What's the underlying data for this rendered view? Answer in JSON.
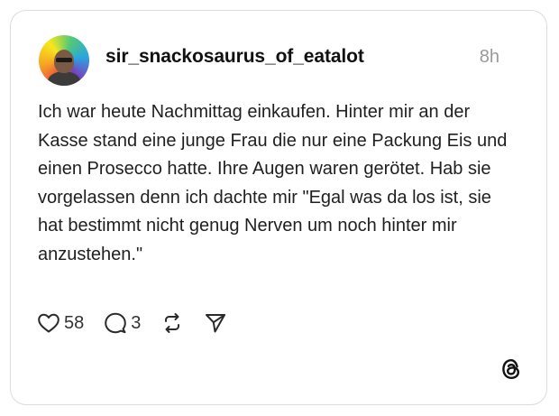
{
  "post": {
    "username": "sir_snackosaurus_of_eatalot",
    "time": "8h",
    "text": "Ich war heute Nachmittag einkaufen. Hinter mir an der Kasse stand eine junge Frau die nur eine Packung Eis und einen Prosecco hatte. Ihre Augen waren gerötet. Hab sie vorgelassen denn ich dachte mir \"Egal was da los ist, sie hat bestimmt nicht genug Nerven um noch hinter mir anzustehen.\""
  },
  "actions": {
    "like_icon": "heart-icon",
    "like_count": "58",
    "reply_icon": "speech-bubble-icon",
    "reply_count": "3",
    "repost_icon": "repost-icon",
    "share_icon": "send-icon"
  },
  "branding": {
    "logo_icon": "threads-logo-icon"
  },
  "colors": {
    "card_border": "#dcdcdc",
    "text": "#1f1f1f",
    "muted": "#9a9a9a"
  }
}
